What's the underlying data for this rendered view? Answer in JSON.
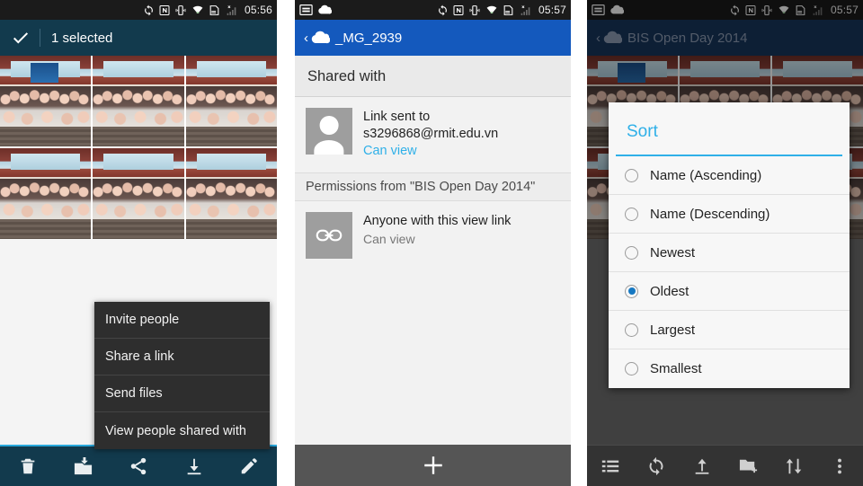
{
  "statusbar": {
    "time_left": "05:56",
    "time_right": "05:57",
    "icons": [
      "sync-icon",
      "nfc-icon",
      "vibrate-icon",
      "wifi-icon",
      "sd-card-icon",
      "signal-off-icon"
    ],
    "left_icons": [
      "screenshot-icon",
      "cloud-icon"
    ]
  },
  "panel1": {
    "actionbar": {
      "check_icon": "check-icon",
      "title": "1 selected"
    },
    "grid": {
      "photos": [
        {
          "name": "group-photo-1",
          "selected": true
        },
        {
          "name": "group-photo-2",
          "selected": false
        },
        {
          "name": "group-photo-3",
          "selected": false
        },
        {
          "name": "group-photo-4",
          "selected": false
        },
        {
          "name": "group-photo-5",
          "selected": false
        },
        {
          "name": "group-photo-6",
          "selected": false
        }
      ]
    },
    "context_menu": {
      "items": [
        {
          "label": "Invite people"
        },
        {
          "label": "Share a link"
        },
        {
          "label": "Send files"
        },
        {
          "label": "View people shared with"
        }
      ]
    },
    "toolbar": {
      "items": [
        {
          "name": "delete-icon",
          "label": "Delete"
        },
        {
          "name": "move-to-folder-icon",
          "label": "Move"
        },
        {
          "name": "share-icon",
          "label": "Share"
        },
        {
          "name": "download-icon",
          "label": "Download"
        },
        {
          "name": "edit-icon",
          "label": "Edit"
        }
      ]
    },
    "accent_color": "#29a8dc",
    "bar_color": "#123a4d"
  },
  "panel2": {
    "actionbar": {
      "back_icon": "back-chevron-icon",
      "cloud_icon": "cloud-icon",
      "title": "_MG_2939"
    },
    "section_header": "Shared with",
    "shared_row": {
      "avatar": "person-avatar",
      "title": "Link sent to",
      "email": "s3296868@rmit.edu.vn",
      "permission": "Can view"
    },
    "permissions_note": "Permissions from \"BIS Open Day 2014\"",
    "link_row": {
      "icon": "link-icon",
      "title": "Anyone with this view link",
      "permission": "Can view"
    },
    "toolbar": {
      "add_icon": "plus-icon",
      "add_label": "Add"
    },
    "bar_color": "#1459bd"
  },
  "panel3": {
    "actionbar": {
      "back_icon": "back-chevron-icon",
      "cloud_icon": "cloud-icon",
      "title": "BIS Open Day 2014"
    },
    "dialog": {
      "title": "Sort",
      "options": [
        {
          "label": "Name (Ascending)",
          "selected": false
        },
        {
          "label": "Name (Descending)",
          "selected": false
        },
        {
          "label": "Newest",
          "selected": false
        },
        {
          "label": "Oldest",
          "selected": true
        },
        {
          "label": "Largest",
          "selected": false
        },
        {
          "label": "Smallest",
          "selected": false
        }
      ],
      "accent_color": "#2fb0e8"
    },
    "toolbar": {
      "items": [
        {
          "name": "list-view-icon",
          "label": "View"
        },
        {
          "name": "refresh-icon",
          "label": "Refresh"
        },
        {
          "name": "upload-icon",
          "label": "Upload"
        },
        {
          "name": "new-folder-icon",
          "label": "New folder"
        },
        {
          "name": "sort-icon",
          "label": "Sort"
        },
        {
          "name": "overflow-menu-icon",
          "label": "More"
        }
      ]
    },
    "bar_color": "#17365c"
  }
}
